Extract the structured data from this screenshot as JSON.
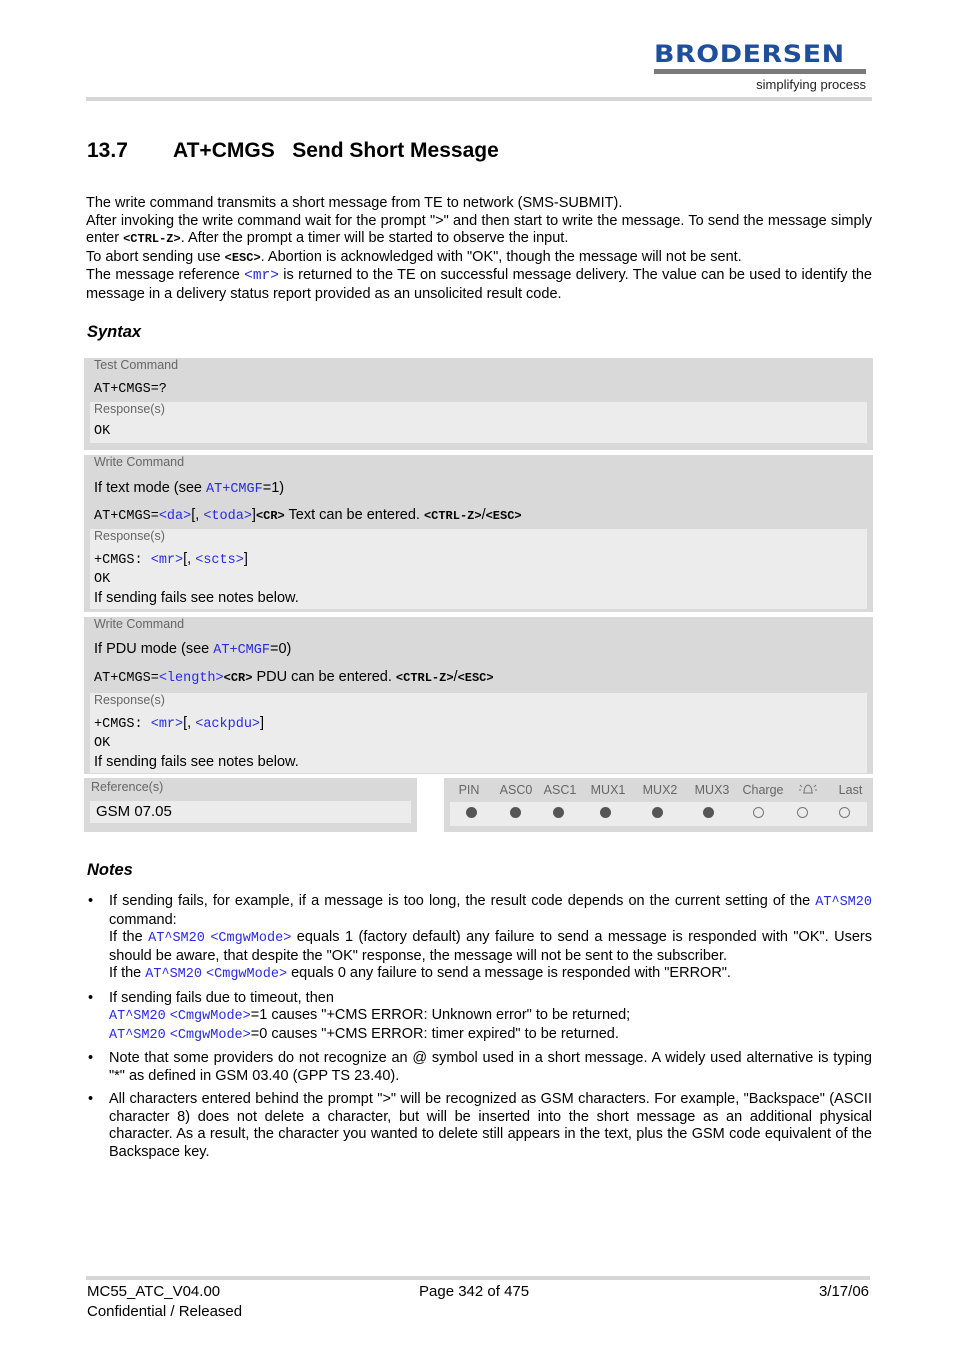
{
  "header": {
    "logo_brand": "BRODERSEN",
    "logo_tagline": "simplifying process"
  },
  "title": {
    "number": "13.7",
    "text": "AT+CMGS   Send Short Message"
  },
  "intro": {
    "line1": "The write command transmits a short message from TE to network (SMS-SUBMIT).",
    "line2a": "After invoking the write command wait for the prompt \">\" and then start to write the message. To send the message simply enter ",
    "line2_kbd": "<CTRL-Z>",
    "line2b": ". After the prompt a timer will be started to observe the input.",
    "line3a": "To abort sending use ",
    "line3_kbd": "<ESC>",
    "line3b": ". Abortion is acknowledged with \"OK\", though the message will not be sent.",
    "line4a": "The message reference ",
    "line4_link": "<mr>",
    "line4b": " is returned to the TE on successful message delivery. The value can be used to identify the message in a delivery status report provided as an unsolicited result code."
  },
  "syntax": {
    "heading": "Syntax",
    "test": {
      "label": "Test Command",
      "command": "AT+CMGS=?",
      "response_label": "Response(s)",
      "response": "OK"
    },
    "write_text": {
      "label": "Write Command",
      "cond_a": "If text mode (see ",
      "cond_link": "AT+CMGF",
      "cond_b": "=1)",
      "cmd_prefix": "AT+CMGS=",
      "cmd_p1": "<da>",
      "cmd_sep": "[, ",
      "cmd_p2": "<toda>",
      "cmd_close": "]",
      "cmd_cr": "<CR>",
      "cmd_text": " Text can be entered. ",
      "cmd_ctrlz": "<CTRL-Z>",
      "cmd_slash": "/",
      "cmd_esc": "<ESC>",
      "response_label": "Response(s)",
      "resp_prefix": "+CMGS: ",
      "resp_p1": "<mr>",
      "resp_sep": "[, ",
      "resp_p2": "<scts>",
      "resp_close": "]",
      "resp_ok": "OK",
      "resp_note": "If sending fails see notes below."
    },
    "write_pdu": {
      "label": "Write Command",
      "cond_a": "If PDU mode (see ",
      "cond_link": "AT+CMGF",
      "cond_b": "=0)",
      "cmd_prefix": "AT+CMGS=",
      "cmd_p1": "<length>",
      "cmd_cr": "<CR>",
      "cmd_text": " PDU can be entered. ",
      "cmd_ctrlz": "<CTRL-Z>",
      "cmd_slash": "/",
      "cmd_esc": "<ESC>",
      "response_label": "Response(s)",
      "resp_prefix": "+CMGS: ",
      "resp_p1": "<mr>",
      "resp_sep": "[, ",
      "resp_p2": "<ackpdu>",
      "resp_close": "]",
      "resp_ok": "OK",
      "resp_note": "If sending fails see notes below."
    },
    "reference": {
      "label": "Reference(s)",
      "value": "GSM 07.05"
    },
    "pins": [
      {
        "name": "PIN",
        "state": "filled"
      },
      {
        "name": "ASC0",
        "state": "filled"
      },
      {
        "name": "ASC1",
        "state": "filled"
      },
      {
        "name": "MUX1",
        "state": "filled"
      },
      {
        "name": "MUX2",
        "state": "filled"
      },
      {
        "name": "MUX3",
        "state": "filled"
      },
      {
        "name": "Charge",
        "state": "empty"
      },
      {
        "name": "alarm-icon",
        "state": "empty"
      },
      {
        "name": "Last",
        "state": "empty"
      }
    ]
  },
  "notes": {
    "heading": "Notes",
    "n1": {
      "a": "If sending fails, for example, if a message is too long, the result code depends on the current setting of the ",
      "link1": "AT^SM20",
      "b": " command:",
      "c": "If the ",
      "link2": "AT^SM20",
      "link3": "<CmgwMode>",
      "d": " equals 1 (factory default) any failure to send a message is responded with \"OK\". Users should be aware, that despite the \"OK\" response, the message will not be sent to the subscriber.",
      "e": "If the ",
      "link4": "AT^SM20",
      "link5": "<CmgwMode>",
      "f": " equals 0 any failure to send a message is responded with \"ERROR\"."
    },
    "n2": {
      "a": "If sending fails due to timeout, then",
      "link1": "AT^SM20",
      "link2": "<CmgwMode>",
      "b": "=1 causes \"+CMS ERROR: Unknown error\" to be returned;",
      "link3": "AT^SM20",
      "link4": "<CmgwMode>",
      "c": "=0 causes \"+CMS ERROR: timer expired\" to be returned."
    },
    "n3": "Note that some providers do not recognize an @ symbol used in a short message. A widely used alternative is typing \"*\" as defined in GSM 03.40 (GPP TS 23.40).",
    "n4": "All characters entered behind the prompt \">\" will be recognized as GSM characters. For example, \"Backspace\" (ASCII character 8) does not delete a character, but will be inserted into the short message as an additional physical character. As a result, the character you wanted to delete still appears in the text, plus the GSM code equivalent of the Backspace key."
  },
  "footer": {
    "doc_id": "MC55_ATC_V04.00",
    "status": "Confidential / Released",
    "page": "Page 342 of 475",
    "date": "3/17/06"
  }
}
